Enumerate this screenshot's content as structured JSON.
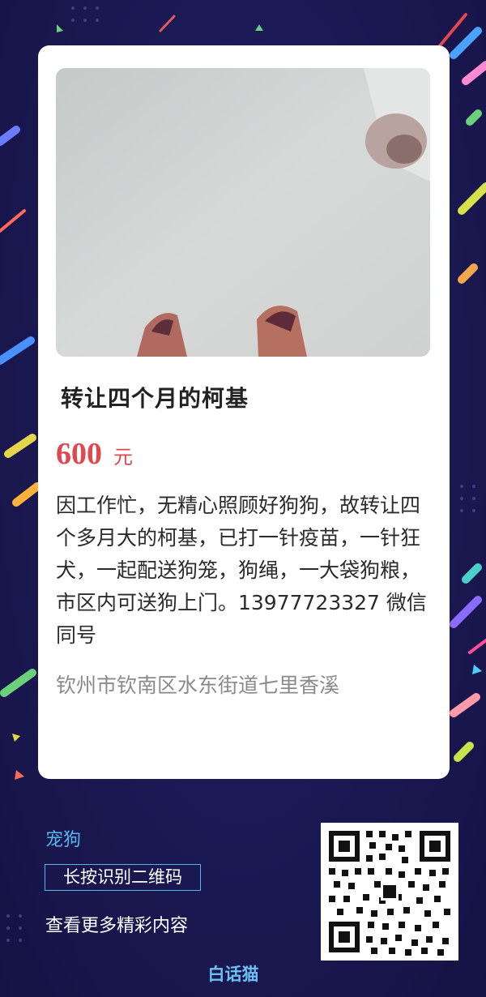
{
  "post": {
    "title": "转让四个月的柯基",
    "price_value": "600",
    "price_unit": "元",
    "description": "因工作忙，无精心照顾好狗狗，故转让四个多月大的柯基，已打一针疫苗，一针狂犬，一起配送狗笼，狗绳，一大袋狗粮，市区内可送狗上门。13977723327  微信同号",
    "address": "钦州市钦南区水东街道七里香溪"
  },
  "footer": {
    "category": "宠狗",
    "scan_hint": "长按识别二维码",
    "more_label": "查看更多精彩内容",
    "brand": "白话猫"
  },
  "icons": {
    "qr": "qr-code-icon"
  },
  "colors": {
    "price": "#e0474e",
    "accent": "#57b6ee",
    "background": "#1c1a55"
  }
}
